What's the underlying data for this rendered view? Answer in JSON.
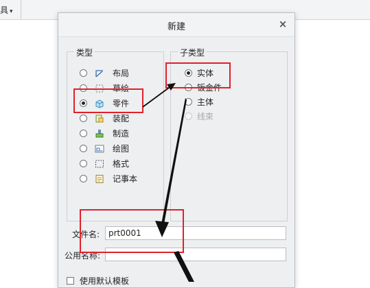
{
  "app": {
    "menu_label": "具",
    "menu_caret": "▾"
  },
  "dialog": {
    "title": "新建",
    "close_glyph": "×"
  },
  "type_group": {
    "legend": "类型",
    "items": [
      {
        "label": "布局",
        "icon": "layout-icon",
        "selected": false
      },
      {
        "label": "草绘",
        "icon": "sketch-icon",
        "selected": false
      },
      {
        "label": "零件",
        "icon": "part-icon",
        "selected": true
      },
      {
        "label": "装配",
        "icon": "assembly-icon",
        "selected": false
      },
      {
        "label": "制造",
        "icon": "manufacturing-icon",
        "selected": false
      },
      {
        "label": "绘图",
        "icon": "drawing-icon",
        "selected": false
      },
      {
        "label": "格式",
        "icon": "format-icon",
        "selected": false
      },
      {
        "label": "记事本",
        "icon": "notebook-icon",
        "selected": false
      }
    ]
  },
  "subtype_group": {
    "legend": "子类型",
    "items": [
      {
        "label": "实体",
        "selected": true,
        "disabled": false
      },
      {
        "label": "钣金件",
        "selected": false,
        "disabled": false
      },
      {
        "label": "主体",
        "selected": false,
        "disabled": false
      },
      {
        "label": "线束",
        "selected": false,
        "disabled": true
      }
    ]
  },
  "fields": {
    "file_name_label": "文件名:",
    "file_name_value": "prt0001",
    "common_name_label": "公用名称:",
    "common_name_value": ""
  },
  "options": {
    "use_default_template_label": "使用默认模板",
    "use_default_template_checked": false
  },
  "colors": {
    "annotation_red": "#e0202a",
    "arrow_black": "#111111"
  }
}
